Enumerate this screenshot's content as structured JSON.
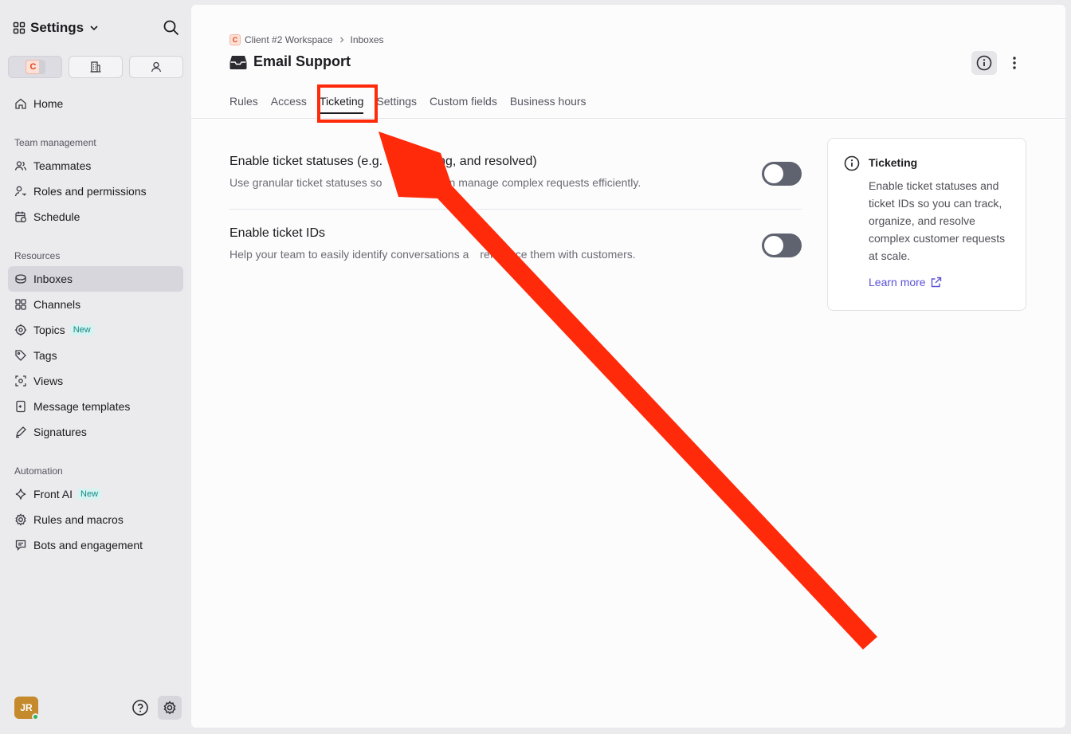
{
  "sidebar": {
    "title": "Settings",
    "workspace_initial": "C",
    "items_top": [
      {
        "label": "Home",
        "icon": "home-icon"
      }
    ],
    "team_management": {
      "label": "Team management",
      "items": [
        {
          "label": "Teammates",
          "icon": "users-icon"
        },
        {
          "label": "Roles and permissions",
          "icon": "user-key-icon"
        },
        {
          "label": "Schedule",
          "icon": "calendar-clock-icon"
        }
      ]
    },
    "resources": {
      "label": "Resources",
      "items": [
        {
          "label": "Inboxes",
          "icon": "inbox-icon",
          "active": true
        },
        {
          "label": "Channels",
          "icon": "grid-icon"
        },
        {
          "label": "Topics",
          "icon": "target-icon",
          "badge": "New"
        },
        {
          "label": "Tags",
          "icon": "tag-icon"
        },
        {
          "label": "Views",
          "icon": "view-icon"
        },
        {
          "label": "Message templates",
          "icon": "template-icon"
        },
        {
          "label": "Signatures",
          "icon": "pen-icon"
        }
      ]
    },
    "automation": {
      "label": "Automation",
      "items": [
        {
          "label": "Front AI",
          "icon": "sparkle-icon",
          "badge": "New"
        },
        {
          "label": "Rules and macros",
          "icon": "cog-icon"
        },
        {
          "label": "Bots and engagement",
          "icon": "chat-icon"
        }
      ]
    },
    "footer": {
      "avatar_initials": "JR"
    }
  },
  "main": {
    "breadcrumb": {
      "workspace_initial": "C",
      "workspace": "Client #2 Workspace",
      "section": "Inboxes"
    },
    "title": "Email Support",
    "tabs": [
      "Rules",
      "Access",
      "Ticketing",
      "Settings",
      "Custom fields",
      "Business hours"
    ],
    "active_tab": "Ticketing",
    "settings": [
      {
        "title": "Enable ticket statuses (e.g.",
        "title_tail": "waiting, and resolved)",
        "desc": "Use granular ticket statuses so",
        "desc_tail": "am can manage complex requests efficiently.",
        "enabled": false
      },
      {
        "title": "Enable ticket IDs",
        "desc": "Help your team to easily identify conversations a",
        "desc_tail": "reference them with customers.",
        "enabled": false
      }
    ],
    "info_card": {
      "title": "Ticketing",
      "body": "Enable ticket statuses and ticket IDs so you can track, organize, and resolve complex customer requests at scale.",
      "link": "Learn more"
    }
  },
  "annotation": {
    "color": "#ff2a0a"
  }
}
